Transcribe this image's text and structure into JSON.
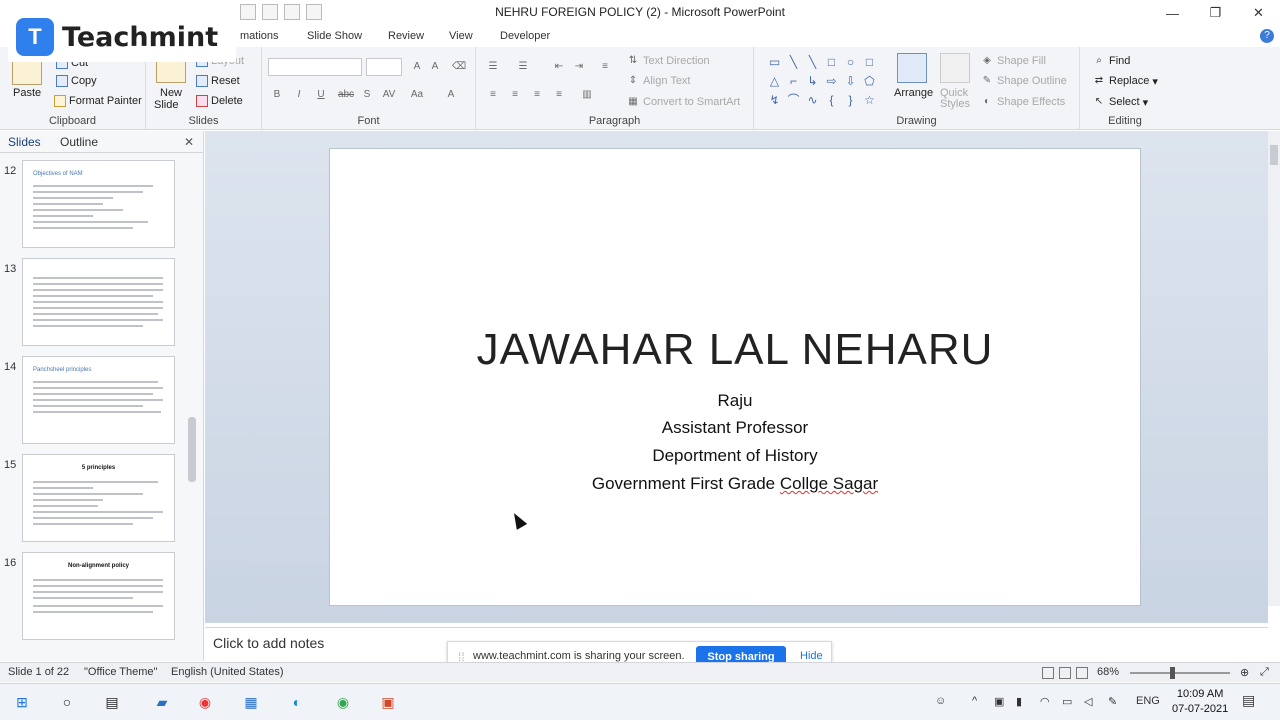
{
  "window": {
    "title": "NEHRU FOREIGN POLICY (2) - Microsoft PowerPoint",
    "minimize": "—",
    "restore": "❐",
    "close": "✕"
  },
  "logo": {
    "mark": "T",
    "word": "Teachmint"
  },
  "ribbon_tabs": [
    "mations",
    "Slide Show",
    "Review",
    "View",
    "Developer"
  ],
  "ribbon": {
    "clipboard": {
      "paste": "Paste",
      "cut": "Cut",
      "copy": "Copy",
      "format_painter": "Format Painter",
      "label": "Clipboard"
    },
    "slides": {
      "new_slide": "New",
      "new_slide_2": "Slide",
      "layout": "Layout",
      "reset": "Reset",
      "delete": "Delete",
      "label": "Slides"
    },
    "font": {
      "label": "Font",
      "bold": "B",
      "italic": "I",
      "underline": "U",
      "strike": "abc",
      "shadow": "S",
      "spacing": "AV",
      "case": "Aa",
      "color": "A"
    },
    "paragraph": {
      "label": "Paragraph",
      "text_direction": "Text Direction",
      "align_text": "Align Text",
      "convert": "Convert to SmartArt"
    },
    "drawing": {
      "label": "Drawing",
      "arrange": "Arrange",
      "quick_styles": "Quick",
      "quick_styles_2": "Styles",
      "shape_fill": "Shape Fill",
      "shape_outline": "Shape Outline",
      "shape_effects": "Shape Effects"
    },
    "editing": {
      "label": "Editing",
      "find": "Find",
      "replace": "Replace",
      "select": "Select"
    }
  },
  "left_panel": {
    "tab_slides": "Slides",
    "tab_outline": "Outline",
    "close": "✕",
    "thumbnails": [
      {
        "number": "12",
        "title": "Objectives of NAM"
      },
      {
        "number": "13",
        "title": ""
      },
      {
        "number": "14",
        "title": "Panchsheel principles"
      },
      {
        "number": "15",
        "title": "5 principles"
      },
      {
        "number": "16",
        "title": "Non-alignment policy"
      }
    ]
  },
  "slide": {
    "title": "JAWAHAR LAL NEHARU",
    "line1": "Raju",
    "line2": "Assistant Professor",
    "line3": "Deportment of History",
    "line4_a": "Government First Grade ",
    "line4_b": "Collge Sagar"
  },
  "notes": {
    "placeholder": "Click to add notes"
  },
  "share_banner": {
    "message": "www.teachmint.com is sharing your screen.",
    "stop": "Stop sharing",
    "hide": "Hide"
  },
  "status": {
    "slide_of": "Slide 1 of 22",
    "theme": "\"Office Theme\"",
    "language": "English (United States)",
    "zoom": "68%"
  },
  "taskbar": {
    "language": "ENG",
    "time": "10:09 AM",
    "date": "07-07-2021"
  }
}
